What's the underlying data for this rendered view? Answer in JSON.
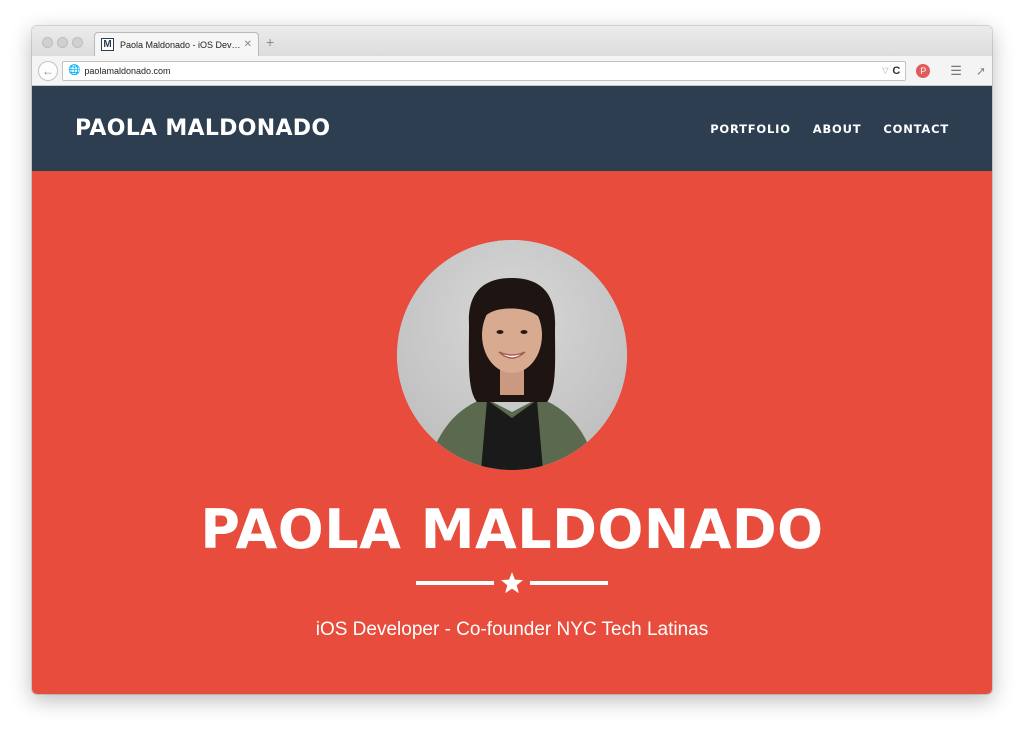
{
  "browser": {
    "tab_title": "Paola Maldonado - iOS Dev…",
    "favicon_letter": "M",
    "url": "paolamaldonado.com"
  },
  "site": {
    "brand": "PAOLA MALDONADO",
    "nav": [
      {
        "label": "PORTFOLIO"
      },
      {
        "label": "ABOUT"
      },
      {
        "label": "CONTACT"
      }
    ]
  },
  "hero": {
    "name": "PAOLA MALDONADO",
    "tagline": "iOS Developer - Co-founder NYC Tech Latinas"
  },
  "colors": {
    "header_bg": "#2c3e50",
    "hero_bg": "#e74c3c",
    "text": "#ffffff"
  },
  "icons": [
    "back-arrow-icon",
    "globe-icon",
    "reload-icon",
    "pinterest-icon",
    "hamburger-menu-icon",
    "extension-icon",
    "star-icon"
  ]
}
